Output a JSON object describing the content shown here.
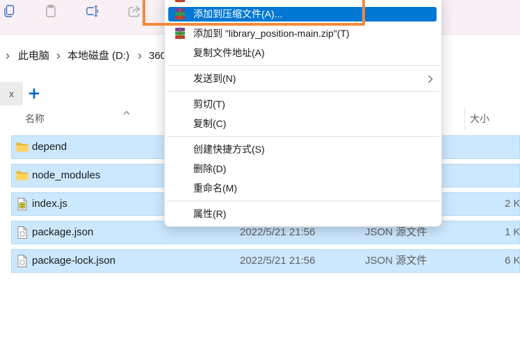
{
  "colors": {
    "toolbar_bg": "#f9f0f5",
    "accent": "#0078d4",
    "selection_bg": "#cce8ff",
    "selection_border": "#b3d9f7",
    "annotation": "#f5893a",
    "new_tab": "#0067c0"
  },
  "toolbar": {
    "buttons": [
      {
        "icon": "copy-icon",
        "enabled": true
      },
      {
        "icon": "paste-icon",
        "enabled": false
      },
      {
        "icon": "rename-icon",
        "enabled": true
      },
      {
        "icon": "share-icon",
        "enabled": false
      }
    ]
  },
  "breadcrumb": {
    "separator": "›",
    "items": [
      "此电脑",
      "本地磁盘 (D:)",
      "360"
    ]
  },
  "tabs": {
    "close_glyph": "x",
    "new_tab_glyph": "+"
  },
  "columns": {
    "name": "名称",
    "size": "大小",
    "sort_icon": "chevron-up-icon"
  },
  "files": [
    {
      "name": "depend",
      "icon": "folder-icon",
      "selected": true
    },
    {
      "name": "node_modules",
      "icon": "folder-icon",
      "selected": true
    },
    {
      "name": "index.js",
      "icon": "js-file-icon",
      "size": "2 K",
      "selected": true
    },
    {
      "name": "package.json",
      "icon": "json-file-icon",
      "modified": "2022/5/21 21:56",
      "type": "JSON 源文件",
      "size": "1 K",
      "selected": true
    },
    {
      "name": "package-lock.json",
      "icon": "json-file-icon",
      "modified": "2022/5/21 21:56",
      "type": "JSON 源文件",
      "size": "6 K",
      "selected": true
    }
  ],
  "context_menu": {
    "groups": [
      [
        {
          "label": "添加到压缩文件(A)...",
          "icon": "winrar-icon",
          "highlighted": true
        },
        {
          "label": "添加到 \"library_position-main.zip\"(T)",
          "icon": "winrar-icon"
        },
        {
          "label": "复制文件地址(A)"
        }
      ],
      [
        {
          "label": "发送到(N)",
          "submenu_icon": "chevron-right-icon"
        }
      ],
      [
        {
          "label": "剪切(T)"
        },
        {
          "label": "复制(C)"
        }
      ],
      [
        {
          "label": "创建快捷方式(S)"
        },
        {
          "label": "删除(D)"
        },
        {
          "label": "重命名(M)"
        }
      ],
      [
        {
          "label": "属性(R)"
        }
      ]
    ]
  }
}
